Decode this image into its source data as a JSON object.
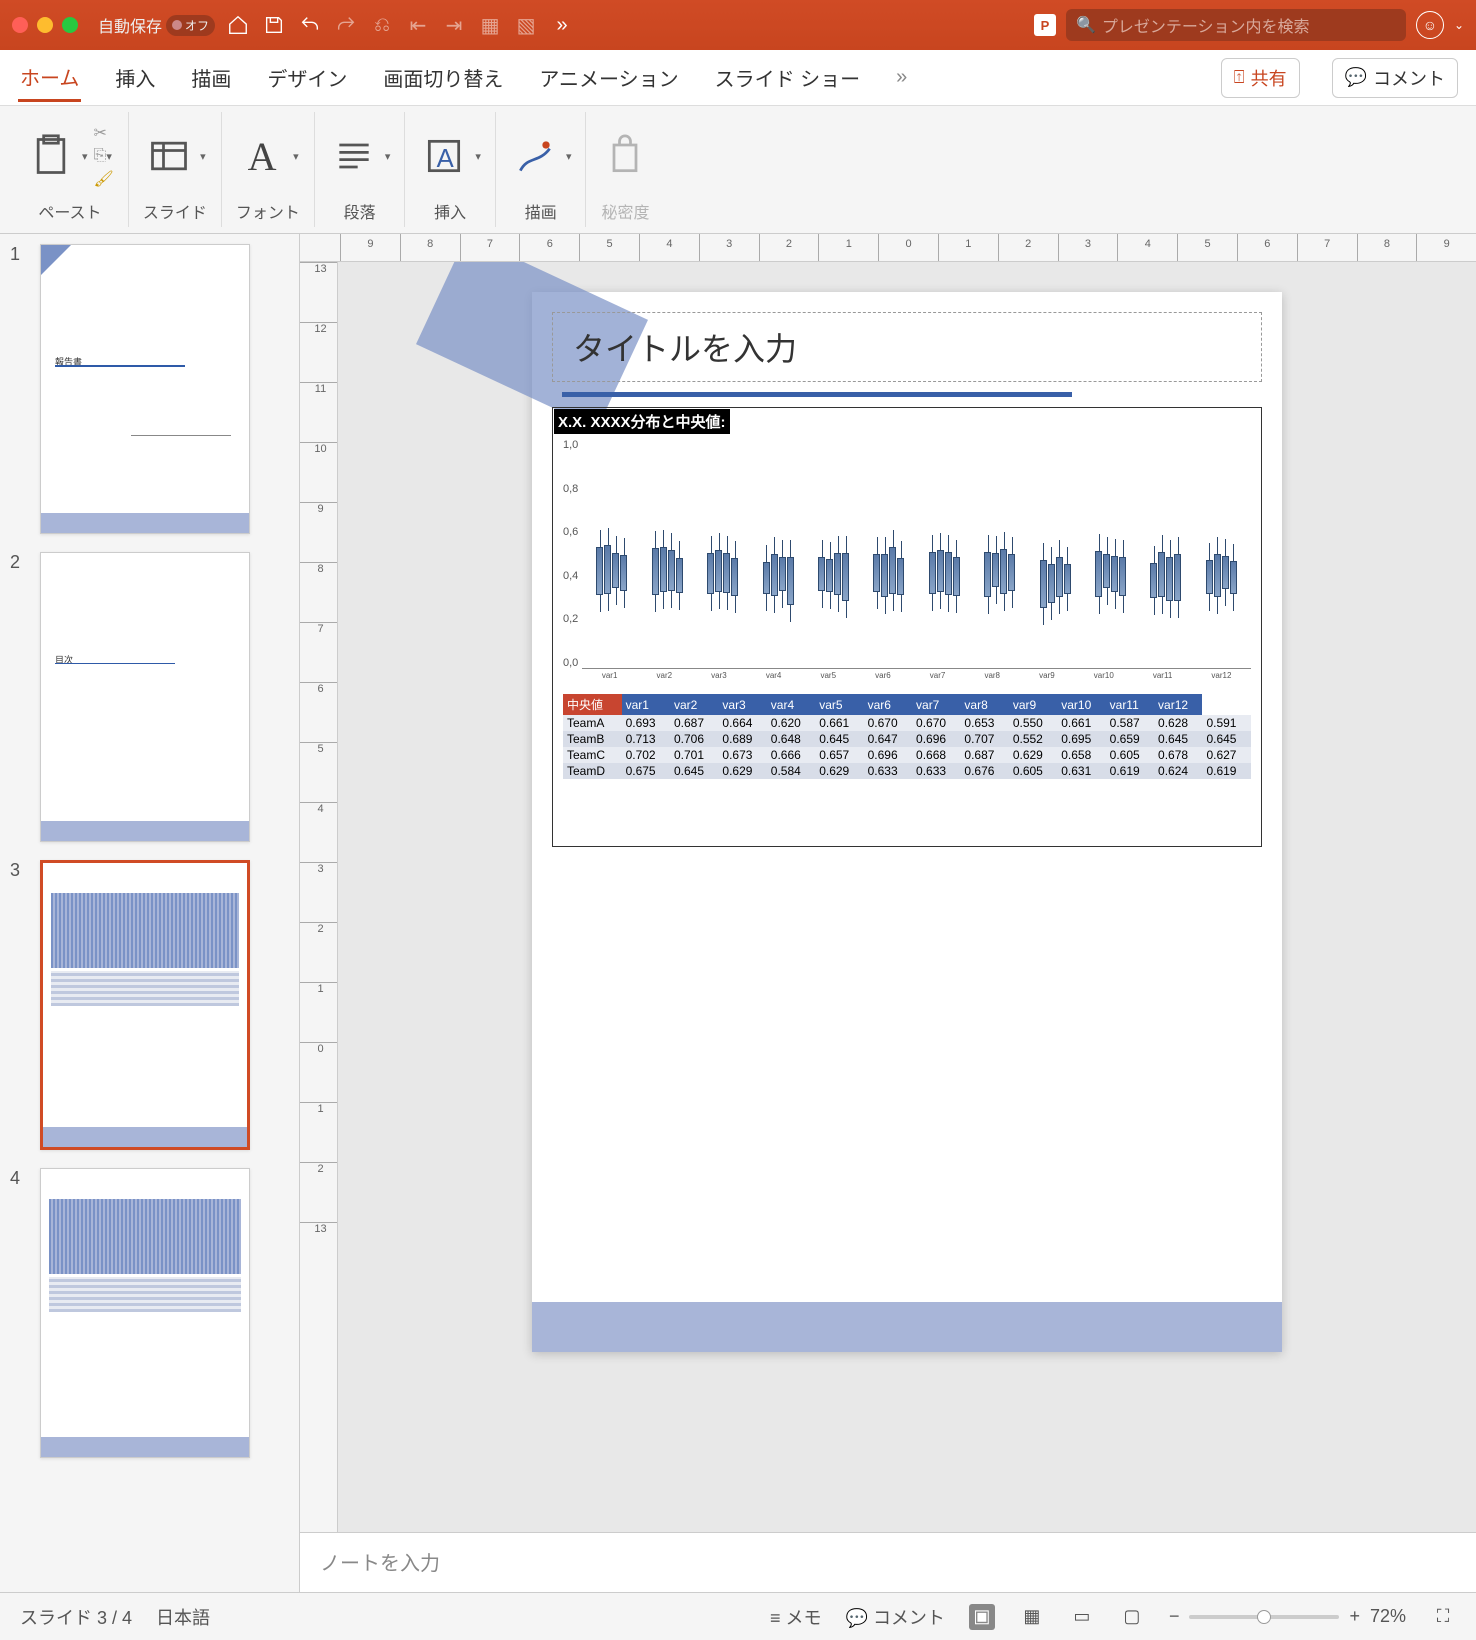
{
  "titlebar": {
    "autosave_label": "自動保存",
    "autosave_state": "オフ",
    "search_placeholder": "プレゼンテーション内を検索"
  },
  "ribbon_tabs": {
    "home": "ホーム",
    "insert": "挿入",
    "draw": "描画",
    "design": "デザイン",
    "transitions": "画面切り替え",
    "animations": "アニメーション",
    "slideshow": "スライド ショー",
    "share": "共有",
    "comment": "コメント"
  },
  "ribbon_groups": {
    "paste": "ペースト",
    "slide": "スライド",
    "font": "フォント",
    "paragraph": "段落",
    "insert": "挿入",
    "drawing": "描画",
    "sensitivity": "秘密度"
  },
  "thumbs": {
    "1": {
      "title": "報告書"
    },
    "2": {
      "title": "目次"
    },
    "3": {},
    "4": {}
  },
  "slide": {
    "title_placeholder": "タイトルを入力",
    "subtitle": "X.X. XXXX分布と中央値:",
    "table": {
      "corner": "中央値",
      "headers": [
        "var1",
        "var2",
        "var3",
        "var4",
        "var5",
        "var6",
        "var7",
        "var8",
        "var9",
        "var10",
        "var11",
        "var12"
      ],
      "rows": [
        {
          "name": "TeamA",
          "vals": [
            "0.693",
            "0.687",
            "0.664",
            "0.620",
            "0.661",
            "0.670",
            "0.670",
            "0.653",
            "0.550",
            "0.661",
            "0.587",
            "0.628",
            "0.591"
          ]
        },
        {
          "name": "TeamB",
          "vals": [
            "0.713",
            "0.706",
            "0.689",
            "0.648",
            "0.645",
            "0.647",
            "0.696",
            "0.707",
            "0.552",
            "0.695",
            "0.659",
            "0.645",
            "0.645"
          ]
        },
        {
          "name": "TeamC",
          "vals": [
            "0.702",
            "0.701",
            "0.673",
            "0.666",
            "0.657",
            "0.696",
            "0.668",
            "0.687",
            "0.629",
            "0.658",
            "0.605",
            "0.678",
            "0.627"
          ]
        },
        {
          "name": "TeamD",
          "vals": [
            "0.675",
            "0.645",
            "0.629",
            "0.584",
            "0.629",
            "0.633",
            "0.633",
            "0.676",
            "0.605",
            "0.631",
            "0.619",
            "0.624",
            "0.619"
          ]
        }
      ]
    }
  },
  "chart_data": {
    "type": "box",
    "title": "XXXX分布と中央値",
    "ylabel": "",
    "ylim": [
      0.0,
      1.0
    ],
    "yticks": [
      0.0,
      0.2,
      0.4,
      0.6,
      0.8,
      1.0
    ],
    "categories": [
      "var1",
      "var2",
      "var3",
      "var4",
      "var5",
      "var6",
      "var7",
      "var8",
      "var9",
      "var10",
      "var11",
      "var12"
    ],
    "series": [
      {
        "name": "TeamA",
        "medians": [
          0.693,
          0.687,
          0.664,
          0.62,
          0.661,
          0.67,
          0.67,
          0.653,
          0.55,
          0.661,
          0.587,
          0.628,
          0.591
        ]
      },
      {
        "name": "TeamB",
        "medians": [
          0.713,
          0.706,
          0.689,
          0.648,
          0.645,
          0.647,
          0.696,
          0.707,
          0.552,
          0.695,
          0.659,
          0.645,
          0.645
        ]
      },
      {
        "name": "TeamC",
        "medians": [
          0.702,
          0.701,
          0.673,
          0.666,
          0.657,
          0.696,
          0.668,
          0.687,
          0.629,
          0.658,
          0.605,
          0.678,
          0.627
        ]
      },
      {
        "name": "TeamD",
        "medians": [
          0.675,
          0.645,
          0.629,
          0.584,
          0.629,
          0.633,
          0.633,
          0.676,
          0.605,
          0.631,
          0.619,
          0.624,
          0.619
        ]
      }
    ]
  },
  "notes_placeholder": "ノートを入力",
  "status": {
    "slide": "スライド 3 / 4",
    "lang": "日本語",
    "notes": "メモ",
    "comments": "コメント",
    "zoom": "72%"
  },
  "ruler_h": [
    "9",
    "8",
    "7",
    "6",
    "5",
    "4",
    "3",
    "2",
    "1",
    "0",
    "1",
    "2",
    "3",
    "4",
    "5",
    "6",
    "7",
    "8",
    "9"
  ],
  "ruler_v": [
    "13",
    "12",
    "11",
    "10",
    "9",
    "8",
    "7",
    "6",
    "5",
    "4",
    "3",
    "2",
    "1",
    "0",
    "1",
    "2",
    "13"
  ]
}
